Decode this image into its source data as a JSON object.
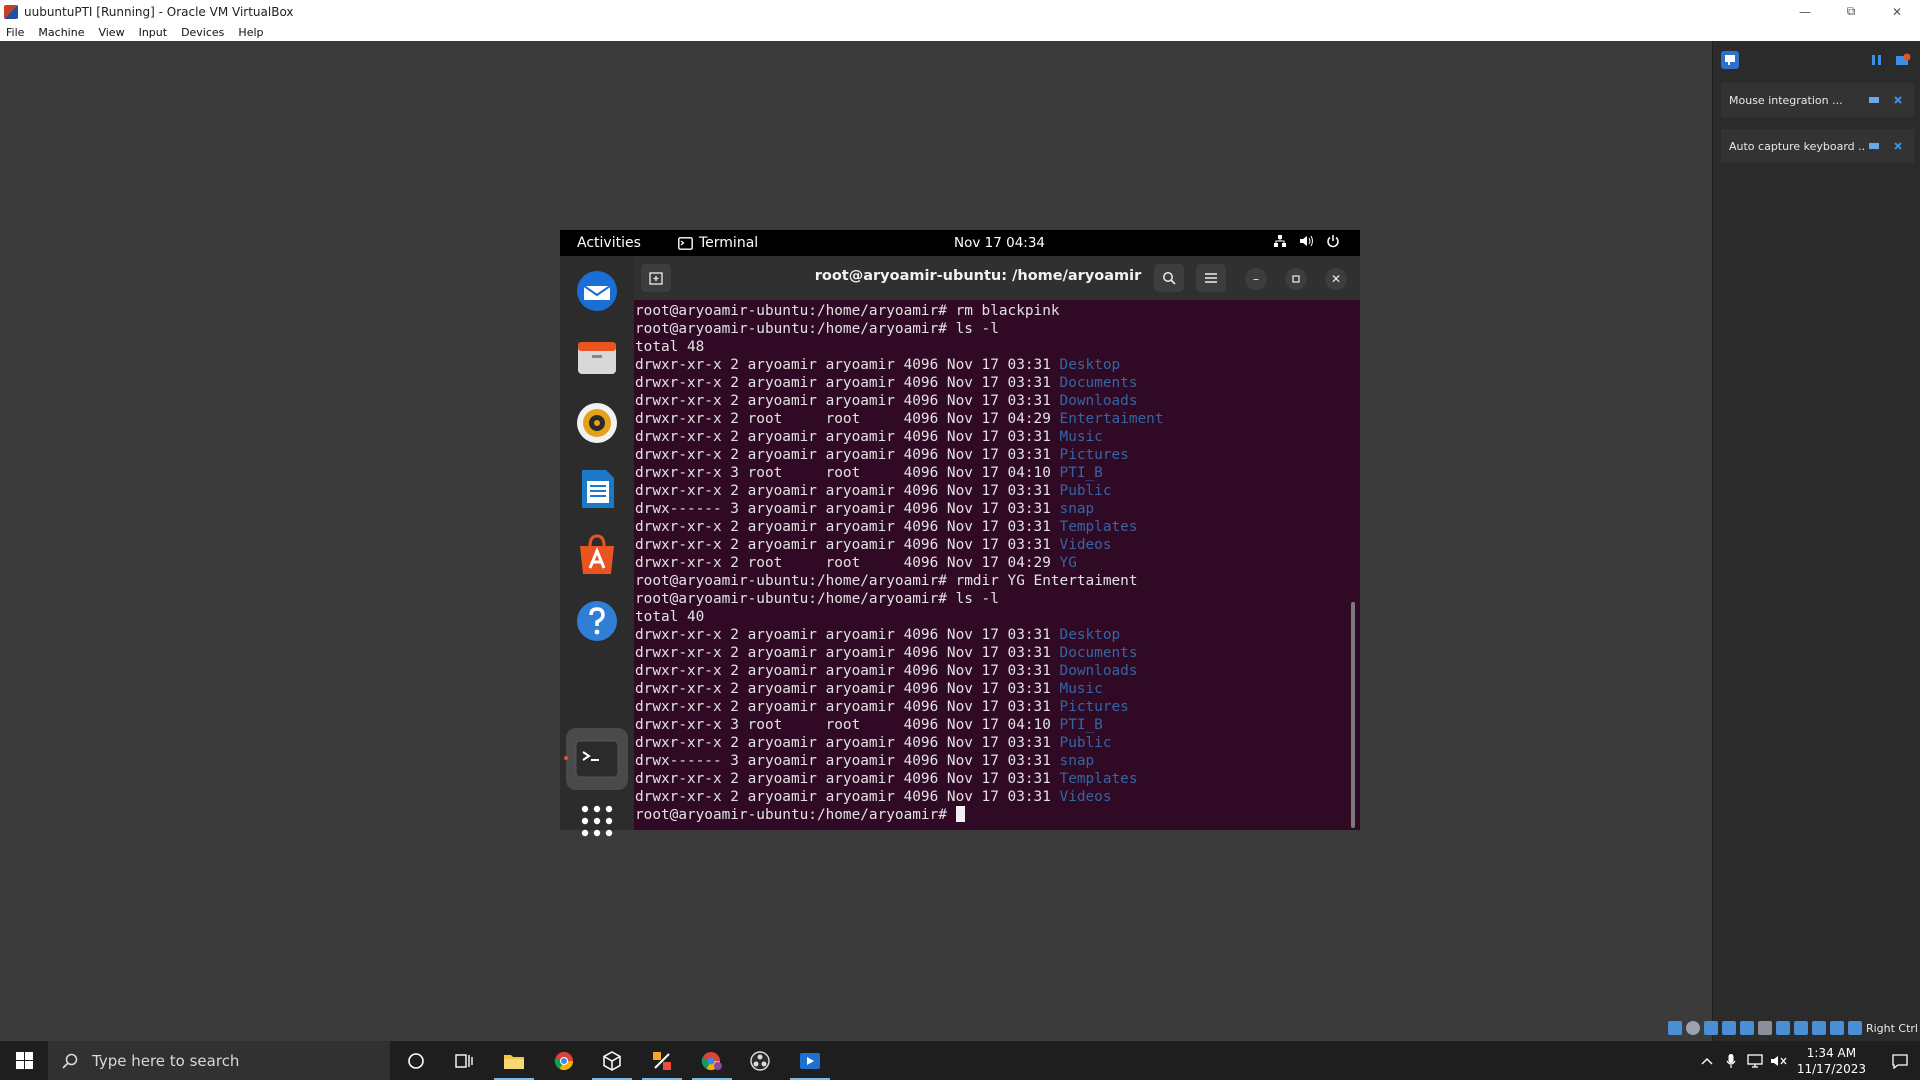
{
  "window": {
    "title": "uubuntuPTI [Running] - Oracle VM VirtualBox",
    "menu": [
      "File",
      "Machine",
      "View",
      "Input",
      "Devices",
      "Help"
    ]
  },
  "notifications": [
    {
      "text": "Mouse integration ..."
    },
    {
      "text": "Auto capture keyboard ..."
    }
  ],
  "statusbar": {
    "host_key": "Right Ctrl"
  },
  "guest": {
    "topbar": {
      "activities": "Activities",
      "app": "Terminal",
      "clock": "Nov 17  04:34"
    },
    "dock": [
      "thunderbird-icon",
      "files-icon",
      "rhythmbox-icon",
      "writer-icon",
      "software-icon",
      "help-icon",
      "terminal-icon",
      "show-apps-icon"
    ],
    "terminal": {
      "title": "root@aryoamir-ubuntu: /home/aryoamir",
      "lines": [
        {
          "prompt": "root@aryoamir-ubuntu:/home/aryoamir#",
          "cmd": " rm blackpink"
        },
        {
          "prompt": "root@aryoamir-ubuntu:/home/aryoamir#",
          "cmd": " ls -l"
        },
        {
          "text": "total 48"
        },
        {
          "text": "drwxr-xr-x 2 aryoamir aryoamir 4096 Nov 17 03:31 ",
          "dir": "Desktop"
        },
        {
          "text": "drwxr-xr-x 2 aryoamir aryoamir 4096 Nov 17 03:31 ",
          "dir": "Documents"
        },
        {
          "text": "drwxr-xr-x 2 aryoamir aryoamir 4096 Nov 17 03:31 ",
          "dir": "Downloads"
        },
        {
          "text": "drwxr-xr-x 2 root     root     4096 Nov 17 04:29 ",
          "dir": "Entertaiment"
        },
        {
          "text": "drwxr-xr-x 2 aryoamir aryoamir 4096 Nov 17 03:31 ",
          "dir": "Music"
        },
        {
          "text": "drwxr-xr-x 2 aryoamir aryoamir 4096 Nov 17 03:31 ",
          "dir": "Pictures"
        },
        {
          "text": "drwxr-xr-x 3 root     root     4096 Nov 17 04:10 ",
          "dir": "PTI_B"
        },
        {
          "text": "drwxr-xr-x 2 aryoamir aryoamir 4096 Nov 17 03:31 ",
          "dir": "Public"
        },
        {
          "text": "drwx------ 3 aryoamir aryoamir 4096 Nov 17 03:31 ",
          "dir": "snap"
        },
        {
          "text": "drwxr-xr-x 2 aryoamir aryoamir 4096 Nov 17 03:31 ",
          "dir": "Templates"
        },
        {
          "text": "drwxr-xr-x 2 aryoamir aryoamir 4096 Nov 17 03:31 ",
          "dir": "Videos"
        },
        {
          "text": "drwxr-xr-x 2 root     root     4096 Nov 17 04:29 ",
          "dir": "YG"
        },
        {
          "prompt": "root@aryoamir-ubuntu:/home/aryoamir#",
          "cmd": " rmdir YG Entertaiment"
        },
        {
          "prompt": "root@aryoamir-ubuntu:/home/aryoamir#",
          "cmd": " ls -l"
        },
        {
          "text": "total 40"
        },
        {
          "text": "drwxr-xr-x 2 aryoamir aryoamir 4096 Nov 17 03:31 ",
          "dir": "Desktop"
        },
        {
          "text": "drwxr-xr-x 2 aryoamir aryoamir 4096 Nov 17 03:31 ",
          "dir": "Documents"
        },
        {
          "text": "drwxr-xr-x 2 aryoamir aryoamir 4096 Nov 17 03:31 ",
          "dir": "Downloads"
        },
        {
          "text": "drwxr-xr-x 2 aryoamir aryoamir 4096 Nov 17 03:31 ",
          "dir": "Music"
        },
        {
          "text": "drwxr-xr-x 2 aryoamir aryoamir 4096 Nov 17 03:31 ",
          "dir": "Pictures"
        },
        {
          "text": "drwxr-xr-x 3 root     root     4096 Nov 17 04:10 ",
          "dir": "PTI_B"
        },
        {
          "text": "drwxr-xr-x 2 aryoamir aryoamir 4096 Nov 17 03:31 ",
          "dir": "Public"
        },
        {
          "text": "drwx------ 3 aryoamir aryoamir 4096 Nov 17 03:31 ",
          "dir": "snap"
        },
        {
          "text": "drwxr-xr-x 2 aryoamir aryoamir 4096 Nov 17 03:31 ",
          "dir": "Templates"
        },
        {
          "text": "drwxr-xr-x 2 aryoamir aryoamir 4096 Nov 17 03:31 ",
          "dir": "Videos"
        },
        {
          "prompt": "root@aryoamir-ubuntu:/home/aryoamir#",
          "cmd": " ",
          "cursor": true
        }
      ]
    }
  },
  "taskbar": {
    "search_placeholder": "Type here to search",
    "apps": [
      "cortana-icon",
      "task-view-icon",
      "file-explorer-icon",
      "chrome-icon",
      "virtualbox-icon",
      "inkscape-icon",
      "chrome-profile-icon",
      "obs-icon",
      "virtualbox-vm-icon"
    ],
    "time": "1:34 AM",
    "date": "11/17/2023"
  },
  "colors": {
    "terminal_bg": "#300a24",
    "dir_blue": "#3465a4",
    "ubuntu_orange": "#e95420"
  }
}
